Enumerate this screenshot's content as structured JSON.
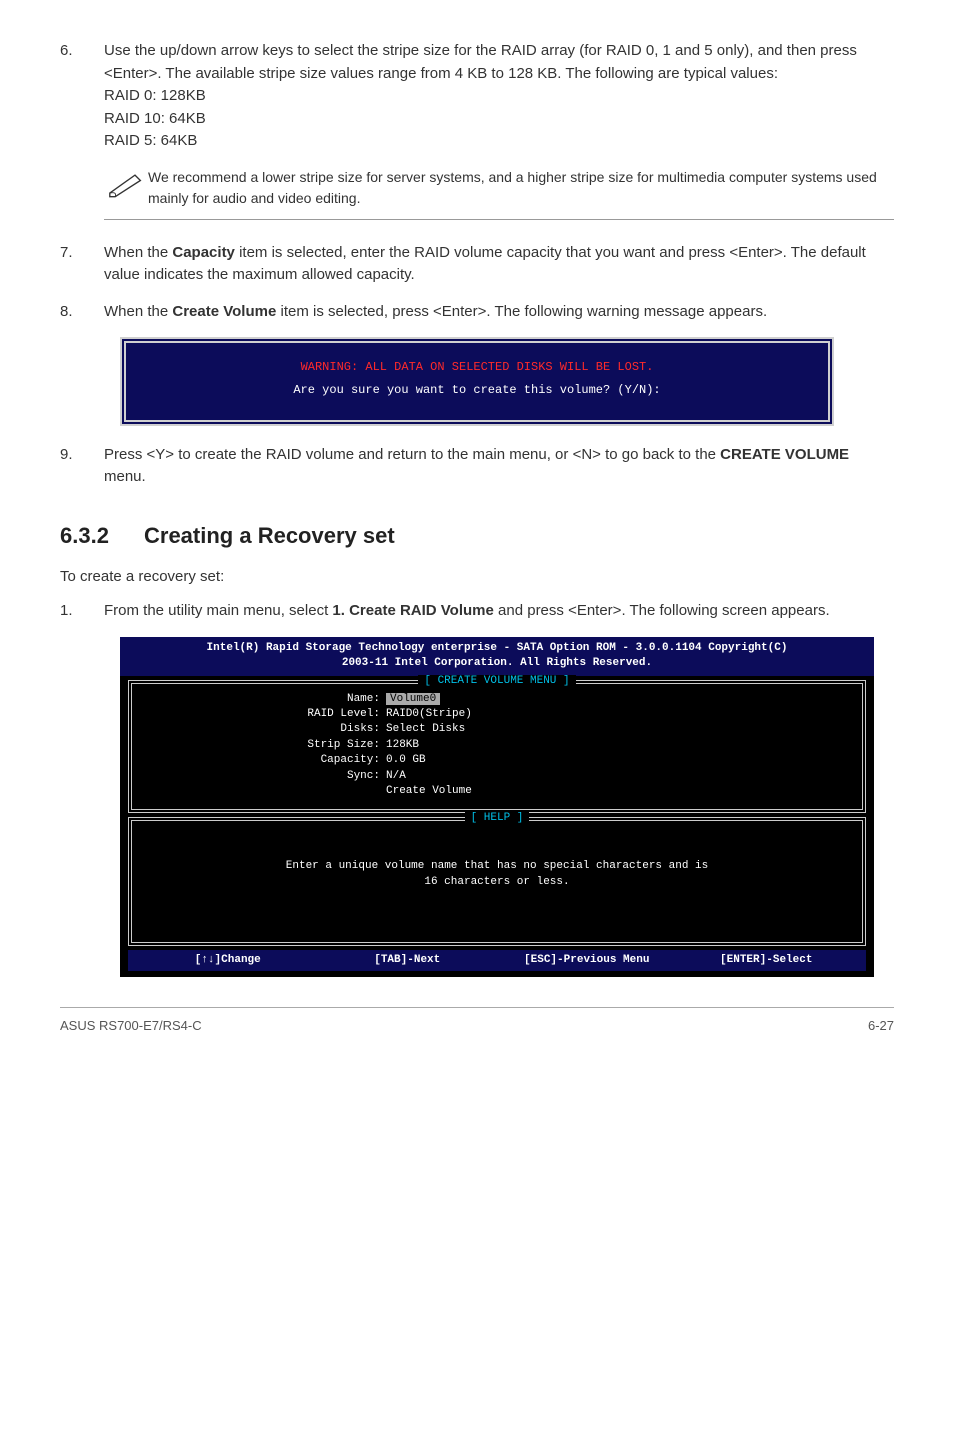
{
  "step6": {
    "num": "6.",
    "para": "Use the up/down arrow keys to select the stripe size for the RAID array (for RAID 0, 1 and 5 only), and then press <Enter>. The available stripe size values range from 4 KB to 128 KB. The following are typical values:",
    "lines": [
      "RAID 0: 128KB",
      "RAID 10: 64KB",
      "RAID 5: 64KB"
    ]
  },
  "note": "We recommend a lower stripe size for server systems, and a higher stripe size for multimedia computer systems used mainly for audio and video editing.",
  "step7": {
    "num": "7.",
    "pre": "When the ",
    "bold": "Capacity",
    "post": " item is selected, enter the RAID volume capacity that you want and press <Enter>. The default value indicates the maximum allowed capacity."
  },
  "step8": {
    "num": "8.",
    "pre": "When the ",
    "bold": "Create Volume",
    "post": " item is selected, press <Enter>. The following warning message appears."
  },
  "bios": {
    "warn": "WARNING: ALL DATA ON SELECTED DISKS WILL BE LOST.",
    "prompt": "Are you sure you want to create this volume? (Y/N):"
  },
  "step9": {
    "num": "9.",
    "pre": "Press <Y> to create the RAID volume and return to the main menu, or <N> to go back to the ",
    "bold": "CREATE VOLUME",
    "post": " menu."
  },
  "section": {
    "num": "6.3.2",
    "title": "Creating a Recovery set"
  },
  "intro": "To create a recovery set:",
  "rstep1": {
    "num": "1.",
    "pre": "From the utility main menu, select ",
    "bold": "1. Create RAID Volume",
    "post": " and press <Enter>. The following screen appears."
  },
  "rom": {
    "header1": "Intel(R) Rapid Storage Technology enterprise - SATA Option ROM - 3.0.0.1104 Copyright(C)",
    "header2": "2003-11 Intel Corporation.  All Rights Reserved.",
    "menuTitle": "[ CREATE VOLUME MENU ]",
    "fields": {
      "name_k": "Name:",
      "name_v": "Volume0",
      "raid_k": "RAID Level:",
      "raid_v": "RAID0(Stripe)",
      "disks_k": "Disks:",
      "disks_v": "Select Disks",
      "strip_k": "Strip Size:",
      "strip_v": "128KB",
      "cap_k": "Capacity:",
      "cap_v": "0.0   GB",
      "sync_k": "Sync:",
      "sync_v": "N/A",
      "create": "Create Volume"
    },
    "helpTitle": "[ HELP ]",
    "help1": "Enter a unique volume name that has no special characters and is",
    "help2": "16 characters or less.",
    "footer": {
      "f1": "[↑↓]Change",
      "f2": "[TAB]-Next",
      "f3": "[ESC]-Previous Menu",
      "f4": "[ENTER]-Select"
    }
  },
  "footer": {
    "left": "ASUS RS700-E7/RS4-C",
    "right": "6-27"
  }
}
